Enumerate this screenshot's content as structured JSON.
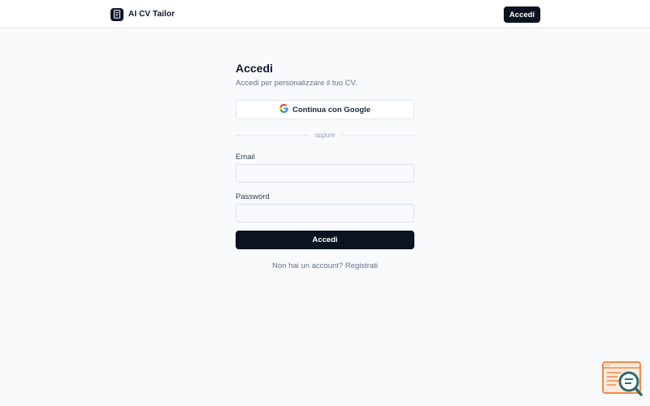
{
  "header": {
    "brand_name": "AI CV Tailor",
    "login_button": "Accedi"
  },
  "login": {
    "title": "Accedi",
    "subtitle": "Accedi per personalizzare il tuo CV.",
    "google_button": "Continua con Google",
    "divider_text": "oppure",
    "email_label": "Email",
    "email_value": "",
    "email_placeholder": "",
    "password_label": "Password",
    "password_value": "",
    "password_placeholder": "",
    "submit_button": "Accedi",
    "signup_prompt": "Non hai un account?",
    "signup_link": "Registrati"
  },
  "icons": {
    "brand": "document-icon",
    "google": "google-icon",
    "widget": "search-chat-icon"
  },
  "colors": {
    "primary": "#0b1220",
    "background": "#f8fafc",
    "widget_orange": "#f08a4b",
    "widget_teal": "#2f6b6b"
  }
}
